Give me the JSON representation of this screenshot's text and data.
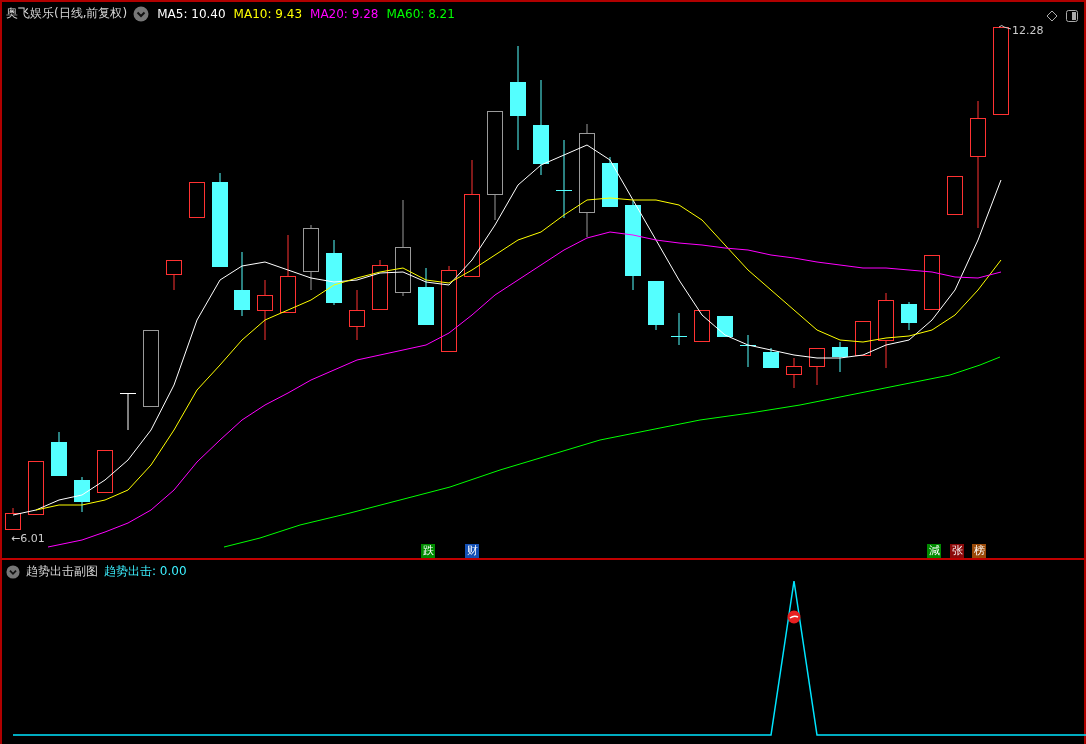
{
  "header": {
    "title": "奥飞娱乐(日线,前复权)",
    "indicators": [
      {
        "label": "MA5: 10.40",
        "color": "#ffffff"
      },
      {
        "label": "MA10: 9.43",
        "color": "#ffff00"
      },
      {
        "label": "MA20: 9.28",
        "color": "#ff00ff"
      },
      {
        "label": "MA60: 8.21",
        "color": "#00ff00"
      }
    ]
  },
  "price_chart": {
    "high_label": "12.28",
    "low_label": "←6.01",
    "signals": [
      {
        "label": "跌",
        "color": "#008a00"
      },
      {
        "label": "财",
        "color": "#1450b4"
      },
      {
        "label": "減",
        "color": "#008a00"
      },
      {
        "label": "张",
        "color": "#8a0a0a"
      },
      {
        "label": "榜",
        "color": "#9a4a08"
      }
    ]
  },
  "sub_chart": {
    "title": "趋势出击副图",
    "indicator": "趋势出击: 0.00"
  }
}
